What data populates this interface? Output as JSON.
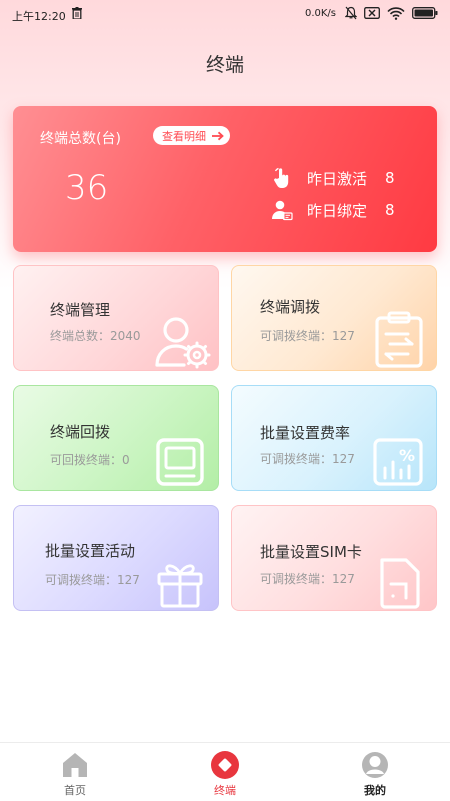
{
  "status_bar": {
    "time": "上午12:20",
    "speed": "0.0K/s"
  },
  "page": {
    "title": "终端"
  },
  "summary": {
    "label": "终端总数(台)",
    "detail_button": "查看明细",
    "total": "36",
    "yesterday_activated_label": "昨日激活",
    "yesterday_activated_value": "8",
    "yesterday_bound_label": "昨日绑定",
    "yesterday_bound_value": "8"
  },
  "tiles": [
    {
      "title": "终端管理",
      "subtitle": "终端总数：2040",
      "icon": "user-gear-icon"
    },
    {
      "title": "终端调拨",
      "subtitle": "可调拨终端：127",
      "icon": "clipboard-transfer-icon"
    },
    {
      "title": "终端回拨",
      "subtitle": "可回拨终端：0",
      "icon": "terminal-device-icon"
    },
    {
      "title": "批量设置费率",
      "subtitle": "可调拨终端：127",
      "icon": "rate-percent-icon"
    },
    {
      "title": "批量设置活动",
      "subtitle": "可调拨终端：127",
      "icon": "gift-icon"
    },
    {
      "title": "批量设置SIM卡",
      "subtitle": "可调拨终端：127",
      "icon": "sim-card-icon"
    }
  ],
  "bottom_nav": [
    {
      "label": "首页",
      "icon": "home-icon"
    },
    {
      "label": "终端",
      "icon": "terminal-icon",
      "active": true
    },
    {
      "label": "我的",
      "icon": "profile-icon"
    }
  ],
  "colors": {
    "accent": "#ff4b52",
    "nav_active": "#e8363e"
  }
}
